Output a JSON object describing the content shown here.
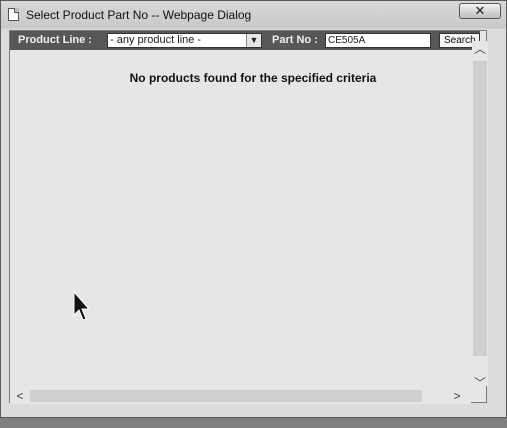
{
  "window": {
    "title": "Select Product Part No -- Webpage Dialog",
    "close_label": "✕"
  },
  "search": {
    "product_line_label": "Product Line :",
    "product_line_value": "- any product line -",
    "part_no_label": "Part No :",
    "part_no_value": "CE505A",
    "search_button_label": "Search"
  },
  "results": {
    "message": "No products found for the specified criteria"
  },
  "icons": {
    "window_icon": "page-icon",
    "dropdown": "chevron-down-icon",
    "scroll_up": "chevron-up-icon",
    "scroll_down": "chevron-down-icon",
    "scroll_left": "chevron-left-icon",
    "scroll_right": "chevron-right-icon",
    "cursor": "mouse-pointer-icon"
  }
}
